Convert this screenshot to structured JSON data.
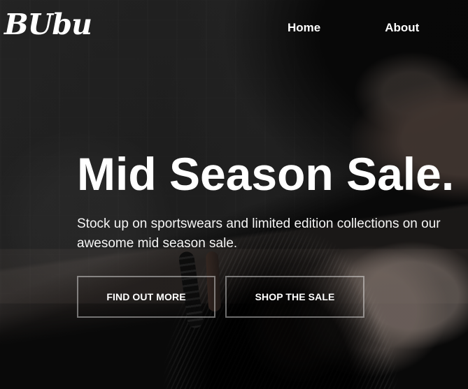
{
  "brand": {
    "name": "BUbu"
  },
  "nav": {
    "home": "Home",
    "about": "About"
  },
  "hero": {
    "title": "Mid Season Sale.",
    "description": "Stock up on sportswears and limited edition collections on our awesome mid season sale."
  },
  "buttons": {
    "find_out_more": "FIND OUT MORE",
    "shop_the_sale": "SHOP THE SALE"
  }
}
